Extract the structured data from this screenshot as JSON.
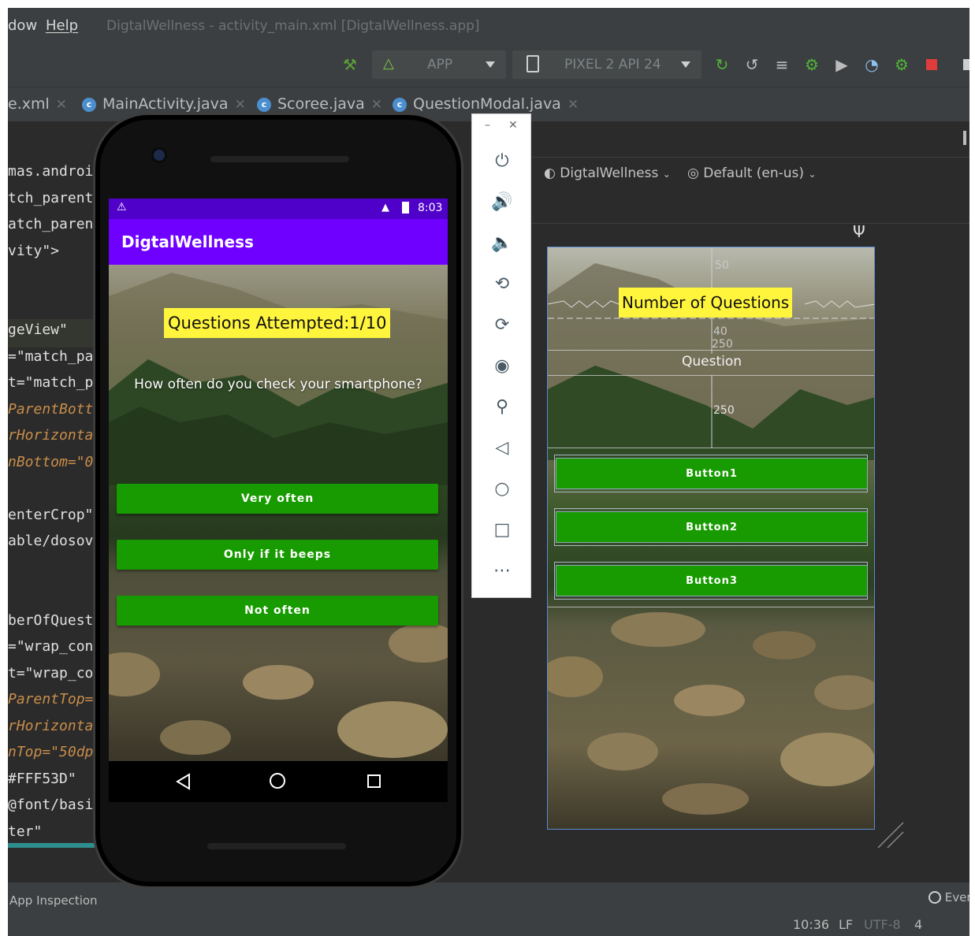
{
  "menu": {
    "window_partial": "dow",
    "help": "Help",
    "title": "DigtalWellness - activity_main.xml [DigtalWellness.app]"
  },
  "toolbar": {
    "run_config": "APP",
    "device": "PIXEL 2 API 24"
  },
  "tabs": [
    {
      "label": "e.xml"
    },
    {
      "label": "MainActivity.java"
    },
    {
      "label": "Scoree.java"
    },
    {
      "label": "QuestionModal.java"
    }
  ],
  "editor_lines": [
    "mas.androi",
    "tch_parent",
    "atch_paren",
    "vity\">",
    "geView\"",
    "=\"match_pa",
    "t=\"match_p",
    "ParentBott",
    "rHorizonta",
    "nBottom=\"0",
    "enterCrop\"",
    "able/dosov",
    "berOfQuest",
    "=\"wrap_con",
    "t=\"wrap_co",
    "ParentTop=",
    "rHorizonta",
    "nTop=\"50dp",
    "#FFF53D\"",
    "@font/basi",
    "ter\""
  ],
  "design": {
    "theme": "DigtalWellness",
    "locale": "Default (en-us)",
    "preview": {
      "title": "Number of Questions",
      "question": "Question",
      "buttons": [
        "Button1",
        "Button2",
        "Button3"
      ],
      "margins": [
        "50",
        "40",
        "250",
        "250"
      ]
    }
  },
  "statusbar": {
    "app_inspection": "App Inspection",
    "event_log": "Ever",
    "time": "10:36",
    "line_sep": "LF",
    "encoding": "UTF-8",
    "indent": "4 spaces"
  },
  "phone": {
    "clock": "8:03",
    "app_title": "DigtalWellness",
    "attempted": "Questions Attempted:1/10",
    "question": "How often do you check your smartphone?",
    "answers": [
      "Very often",
      "Only if it beeps",
      "Not often"
    ]
  },
  "emulator_controls": [
    "power-icon",
    "volume-up-icon",
    "volume-down-icon",
    "rotate-left-icon",
    "rotate-right-icon",
    "camera-icon",
    "zoom-icon",
    "back-icon",
    "home-icon",
    "overview-icon",
    "more-icon"
  ],
  "colors": {
    "app_bar": "#6f00ff",
    "status_bar": "#4f00c9",
    "button": "#189b00",
    "highlight": "#fff53d"
  }
}
